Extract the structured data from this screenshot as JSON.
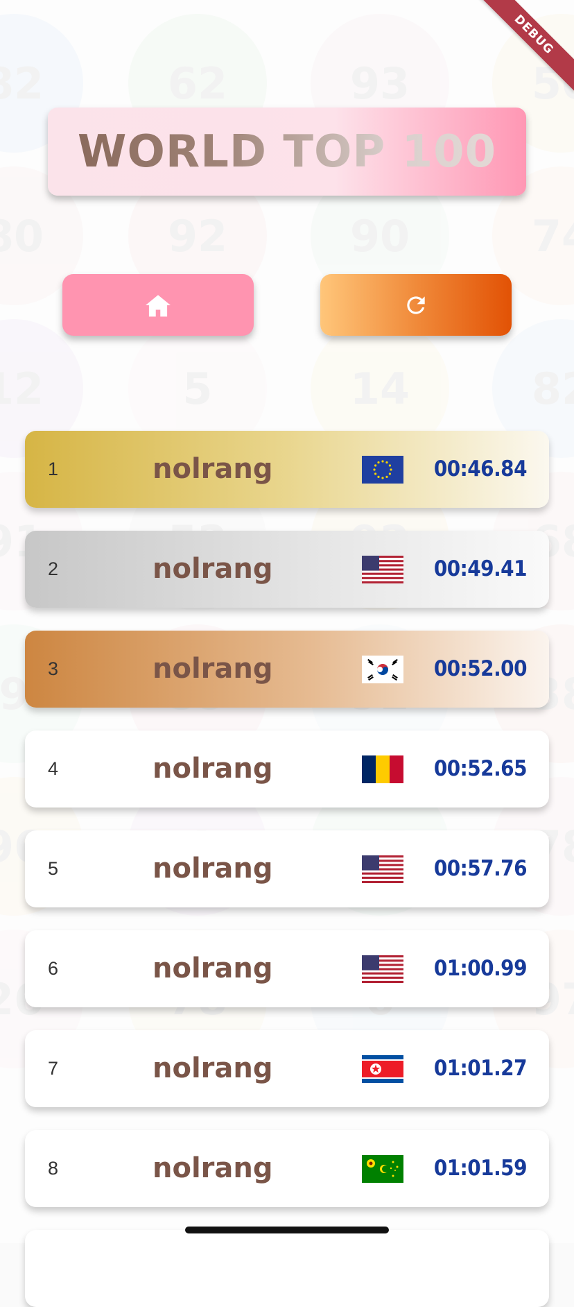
{
  "debug_banner": "DEBUG",
  "title": "WORLD TOP 100",
  "buttons": {
    "home_icon": "home-icon",
    "refresh_icon": "refresh-icon"
  },
  "background_numbers": [
    "82",
    "62",
    "93",
    "50",
    "80",
    "92",
    "90",
    "74",
    "12",
    "5",
    "14",
    "82",
    "91",
    "52",
    "92",
    "68",
    "9",
    "59",
    "92",
    "38",
    "96",
    "4",
    "15",
    "78",
    "26",
    "78",
    "6",
    "97"
  ],
  "leaderboard": [
    {
      "rank": "1",
      "name": "nolrang",
      "flag": "EU",
      "time": "00:46.84"
    },
    {
      "rank": "2",
      "name": "nolrang",
      "flag": "US",
      "time": "00:49.41"
    },
    {
      "rank": "3",
      "name": "nolrang",
      "flag": "KR",
      "time": "00:52.00"
    },
    {
      "rank": "4",
      "name": "nolrang",
      "flag": "TD",
      "time": "00:52.65"
    },
    {
      "rank": "5",
      "name": "nolrang",
      "flag": "US",
      "time": "00:57.76"
    },
    {
      "rank": "6",
      "name": "nolrang",
      "flag": "US",
      "time": "01:00.99"
    },
    {
      "rank": "7",
      "name": "nolrang",
      "flag": "KP",
      "time": "01:01.27"
    },
    {
      "rank": "8",
      "name": "nolrang",
      "flag": "CC",
      "time": "01:01.59"
    }
  ],
  "colors": {
    "gold": "#d6b545",
    "silver": "#c7c7c7",
    "bronze": "#cd8641",
    "name": "#7a5548",
    "time": "#173a9a",
    "home_button": "#ff94b0",
    "refresh_button": "#e25205"
  }
}
